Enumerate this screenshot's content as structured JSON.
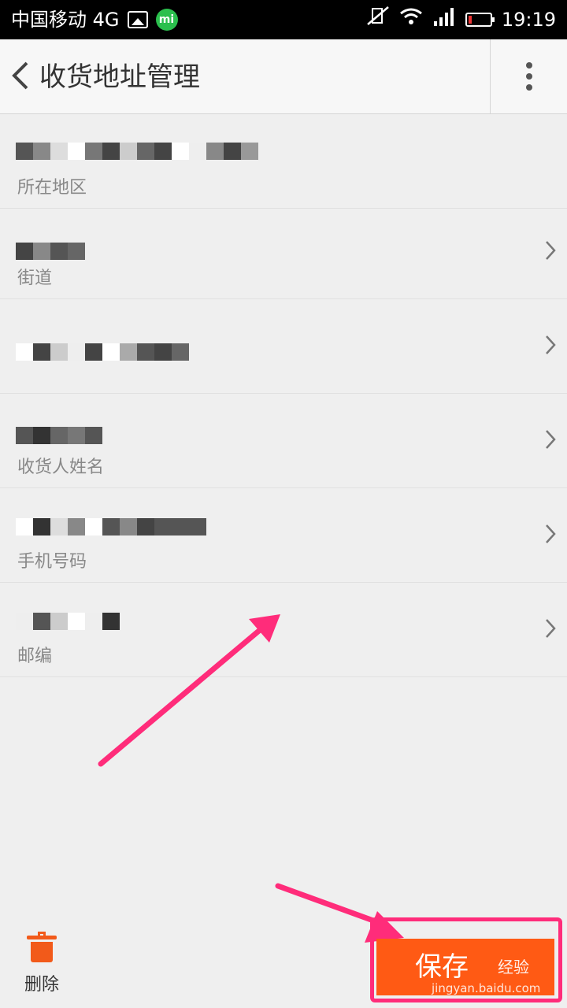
{
  "status_bar": {
    "carrier": "中国移动 4G",
    "mi_label": "mi",
    "time": "19:19"
  },
  "header": {
    "title": "收货地址管理"
  },
  "rows": [
    {
      "label": "所在地区",
      "has_chevron": false
    },
    {
      "label": "街道",
      "has_chevron": true
    },
    {
      "label": "",
      "has_chevron": true
    },
    {
      "label": "收货人姓名",
      "has_chevron": true
    },
    {
      "label": "手机号码",
      "has_chevron": true
    },
    {
      "label": "邮编",
      "has_chevron": true
    }
  ],
  "bottom": {
    "delete_label": "删除",
    "save_label": "保存",
    "watermark": "经验",
    "watermark_url": "jingyan.baidu.com"
  },
  "colors": {
    "accent": "#ff5a14",
    "annotation": "#ff2c7a"
  }
}
